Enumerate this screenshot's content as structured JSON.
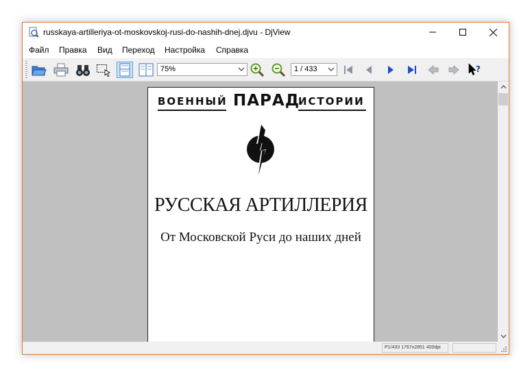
{
  "window": {
    "title": "russkaya-artilleriya-ot-moskovskoj-rusi-do-nashih-dnej.djvu - DjView"
  },
  "menu": {
    "items": [
      {
        "label": "Файл"
      },
      {
        "label": "Правка"
      },
      {
        "label": "Вид"
      },
      {
        "label": "Переход"
      },
      {
        "label": "Настройка"
      },
      {
        "label": "Справка"
      }
    ]
  },
  "toolbar": {
    "zoom_value": "75%",
    "page_value": "1 / 433",
    "icons": [
      "open-icon",
      "print-icon",
      "find-icon",
      "select-icon",
      "continuous-icon",
      "side-by-side-icon",
      "zoom-in-icon",
      "zoom-out-icon",
      "first-page-icon",
      "prev-page-icon",
      "next-page-icon",
      "last-page-icon",
      "back-icon",
      "forward-icon",
      "whats-this-icon"
    ],
    "accent": "#1c50c8"
  },
  "document": {
    "series_word1": "ВОЕННЫЙ",
    "series_word2": "ПАРАД",
    "series_word3": "ИСТОРИИ",
    "title": "РУССКАЯ АРТИЛЛЕРИЯ",
    "subtitle": "От Московской Руси до наших дней"
  },
  "status": {
    "page_info": "P1/433 1767x2851 400dpi",
    "extra": ""
  }
}
